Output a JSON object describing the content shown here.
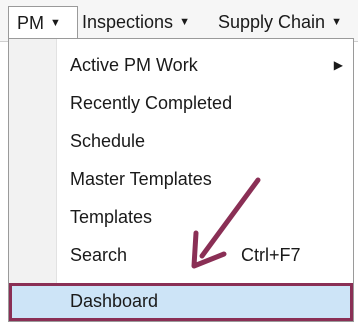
{
  "menubar": {
    "items": [
      {
        "label": "PM"
      },
      {
        "label": "Inspections"
      },
      {
        "label": "Supply Chain"
      }
    ]
  },
  "dropdown": {
    "items": [
      {
        "label": "Active PM Work",
        "has_submenu": true
      },
      {
        "label": "Recently Completed"
      },
      {
        "label": "Schedule"
      },
      {
        "label": "Master Templates"
      },
      {
        "label": "Templates"
      },
      {
        "label": "Search",
        "shortcut": "Ctrl+F7"
      },
      {
        "label": "Dashboard",
        "highlighted": true
      }
    ]
  },
  "colors": {
    "highlight_fill": "#cde4f7",
    "annotation": "#8a2f55"
  },
  "icons": {
    "menu_caret": "caret-down-icon",
    "submenu_arrow": "caret-right-icon",
    "annotation_arrow": "arrow-down-left-icon"
  }
}
